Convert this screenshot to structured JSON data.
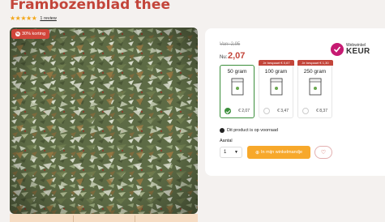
{
  "product": {
    "title": "Frambozenblad thee",
    "stars": "★★★★★",
    "review_link": "1 review",
    "discount_badge": "30% korting"
  },
  "pricing": {
    "old_price": "Van: 2,95",
    "now_label": "Nu:",
    "now_price": "2,07"
  },
  "badge": {
    "top": "Webwinkel",
    "main": "KEUR"
  },
  "options": [
    {
      "size": "50 gram",
      "price": "€ 2,07",
      "saved": "",
      "selected": true
    },
    {
      "size": "100 gram",
      "price": "€ 3,47",
      "saved": "Je bespaart € 0,67",
      "selected": false
    },
    {
      "size": "250 gram",
      "price": "€ 8,37",
      "saved": "Je bespaart € 1,30",
      "selected": false
    }
  ],
  "preorder_text": "Dit product is op voorraad",
  "quantity": {
    "label": "Aantal",
    "value": "1"
  },
  "cart_button": "In mijn winkelmandje",
  "colors": {
    "brand_red": "#c3453a",
    "accent_orange": "#f7a82b",
    "success_green": "#3c8f3c"
  }
}
